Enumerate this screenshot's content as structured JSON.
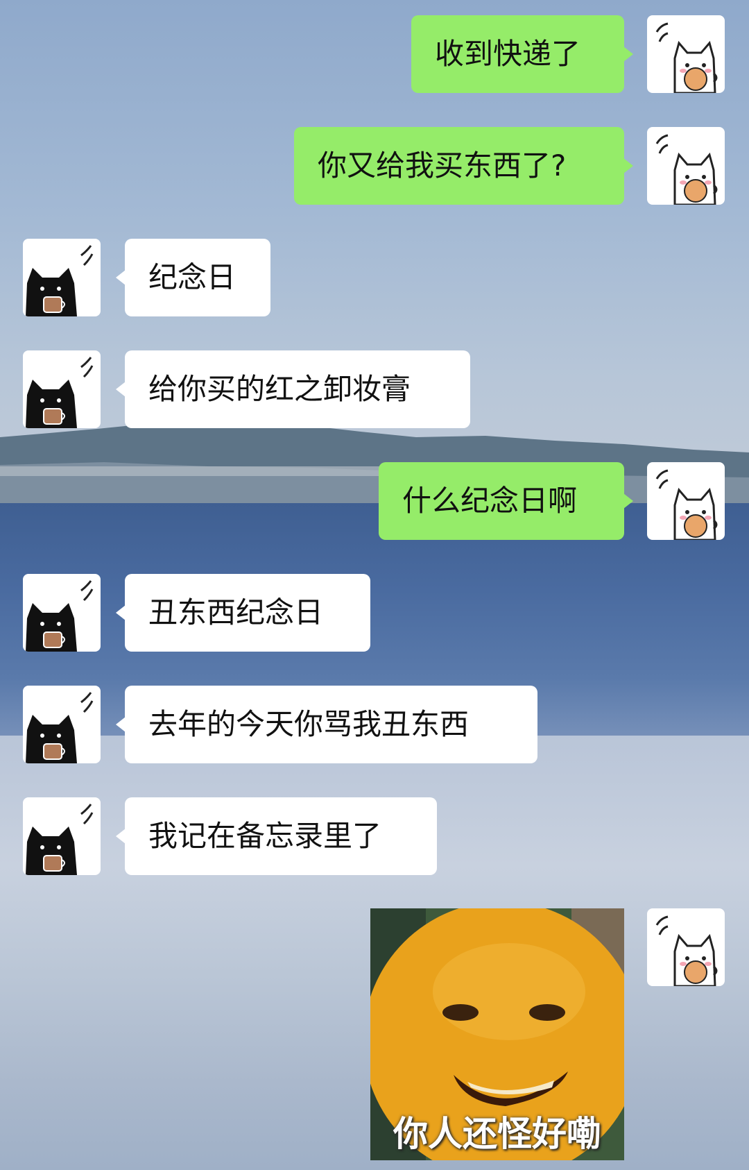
{
  "chat": {
    "messages": [
      {
        "side": "me",
        "text": "收到快递了"
      },
      {
        "side": "me",
        "text": "你又给我买东西了?"
      },
      {
        "side": "other",
        "text": "纪念日"
      },
      {
        "side": "other",
        "text": "给你买的红之卸妆膏"
      },
      {
        "side": "me",
        "text": "什么纪念日啊"
      },
      {
        "side": "other",
        "text": "丑东西纪念日"
      },
      {
        "side": "other",
        "text": "去年的今天你骂我丑东西"
      },
      {
        "side": "other",
        "text": "我记在备忘录里了"
      },
      {
        "side": "me",
        "type": "sticker",
        "caption": "你人还怪好嘞"
      }
    ]
  },
  "avatars": {
    "me": "white-cat-eating-cookie",
    "other": "black-cat-holding-cup"
  },
  "colors": {
    "my_bubble": "#95ec69",
    "their_bubble": "#ffffff"
  }
}
